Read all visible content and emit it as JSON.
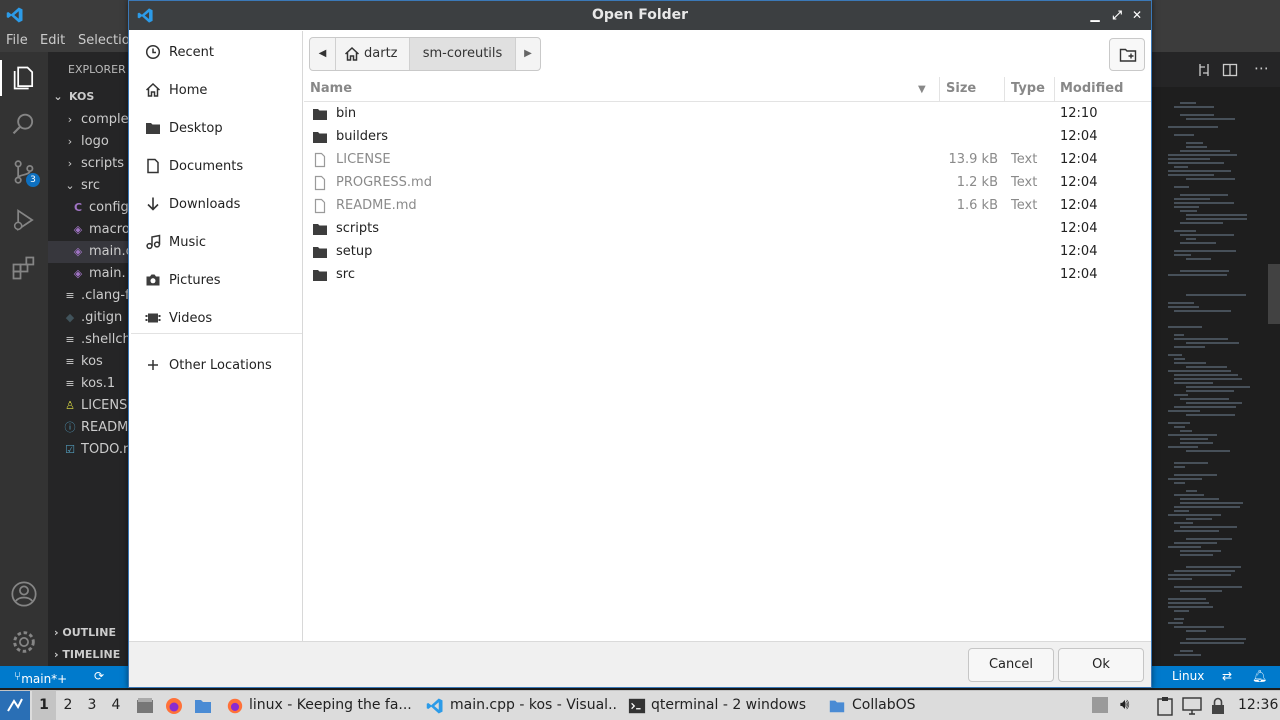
{
  "vscode": {
    "menu": [
      "File",
      "Edit",
      "Selectio"
    ],
    "sidebar_title": "EXPLORER",
    "tree": [
      {
        "label": "KOS",
        "icon": "chevron-down"
      },
      {
        "label": "comple",
        "icon": "chevron-right"
      },
      {
        "label": "logo",
        "icon": "chevron-right"
      },
      {
        "label": "scripts",
        "icon": "chevron-right"
      },
      {
        "label": "src",
        "icon": "chevron-down"
      },
      {
        "label": "config",
        "icon": "c-file"
      },
      {
        "label": "macro",
        "icon": "cpp-file"
      },
      {
        "label": "main.c",
        "icon": "cpp-file"
      },
      {
        "label": "main.",
        "icon": "cpp-file"
      },
      {
        "label": ".clang-f",
        "icon": "lines"
      },
      {
        "label": ".gitign",
        "icon": "git"
      },
      {
        "label": ".shellch",
        "icon": "lines"
      },
      {
        "label": "kos",
        "icon": "lines"
      },
      {
        "label": "kos.1",
        "icon": "lines"
      },
      {
        "label": "LICENS",
        "icon": "license"
      },
      {
        "label": "READM",
        "icon": "info"
      },
      {
        "label": "TODO.r",
        "icon": "todo"
      }
    ],
    "outline_label": "OUTLINE",
    "timeline_label": "TIMELINE",
    "scm_badge": "3",
    "status": {
      "branch": "main*+",
      "language": "Linux"
    }
  },
  "dialog": {
    "title": "Open Folder",
    "places": [
      {
        "label": "Recent",
        "icon": "clock-icon"
      },
      {
        "label": "Home",
        "icon": "home-icon"
      },
      {
        "label": "Desktop",
        "icon": "folder-icon"
      },
      {
        "label": "Documents",
        "icon": "document-icon"
      },
      {
        "label": "Downloads",
        "icon": "download-icon"
      },
      {
        "label": "Music",
        "icon": "music-icon"
      },
      {
        "label": "Pictures",
        "icon": "camera-icon"
      },
      {
        "label": "Videos",
        "icon": "video-icon"
      }
    ],
    "other_locations": "Other Locations",
    "path": [
      "dartz",
      "sm-coreutils"
    ],
    "columns": {
      "name": "Name",
      "size": "Size",
      "type": "Type",
      "modified": "Modified"
    },
    "files": [
      {
        "name": "bin",
        "kind": "folder",
        "size": "",
        "type": "",
        "modified": "12:10"
      },
      {
        "name": "builders",
        "kind": "folder",
        "size": "",
        "type": "",
        "modified": "12:04"
      },
      {
        "name": "LICENSE",
        "kind": "file",
        "size": "13.9 kB",
        "type": "Text",
        "modified": "12:04"
      },
      {
        "name": "PROGRESS.md",
        "kind": "file",
        "size": "1.2 kB",
        "type": "Text",
        "modified": "12:04"
      },
      {
        "name": "README.md",
        "kind": "file",
        "size": "1.6 kB",
        "type": "Text",
        "modified": "12:04"
      },
      {
        "name": "scripts",
        "kind": "folder",
        "size": "",
        "type": "",
        "modified": "12:04"
      },
      {
        "name": "setup",
        "kind": "folder",
        "size": "",
        "type": "",
        "modified": "12:04"
      },
      {
        "name": "src",
        "kind": "folder",
        "size": "",
        "type": "",
        "modified": "12:04"
      }
    ],
    "cancel_label": "Cancel",
    "ok_label": "Ok"
  },
  "taskbar": {
    "workspaces": [
      "1",
      "2",
      "3",
      "4"
    ],
    "windows": [
      {
        "label": "linux - Keeping the fa...",
        "icon": "firefox-icon"
      },
      {
        "label": "main.cpp - kos - Visual...",
        "icon": "vscode-icon"
      },
      {
        "label": "qterminal - 2 windows",
        "icon": "terminal-icon"
      },
      {
        "label": "CollabOS",
        "icon": "folder-icon"
      }
    ],
    "clock": "12:36"
  },
  "colors": {
    "accent": "#007acc",
    "dialog_border": "#3b79b8",
    "folder": "#3d3d3d"
  }
}
